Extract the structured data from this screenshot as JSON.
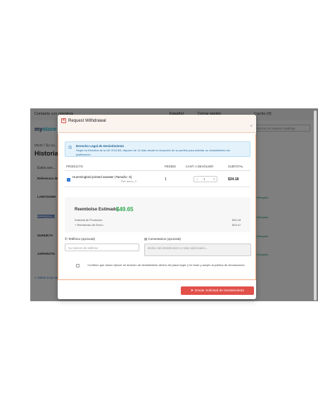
{
  "background_site": {
    "contact": "Contacte con nosotros",
    "language": "Español",
    "signin": "Cerrar sesión",
    "cart": "Carrito (0)",
    "logo_a": "my",
    "logo_b": "store",
    "search_placeholder": "Buscar en nuestro catálogo",
    "breadcrumb": "Inicio / Su cu...",
    "page_title": "Historial",
    "sub": "Estos son...",
    "rows": [
      "Referencia del pedido",
      "LAMYGUNH",
      "DRHQSULJ",
      "UUHUILTA",
      "AXPHSUTG"
    ],
    "badges": [
      "Entregado",
      "Entregado",
      "Entregado",
      "Entregado"
    ],
    "footer_link": "< Volver a su cuenta",
    "bottom_link": "Volver a su cuenta"
  },
  "modal": {
    "title": "Request Withdrawal",
    "close_icon": "times",
    "legal": {
      "icon": "gavel-icon",
      "title": "Derecho Legal de Desistimiento",
      "text": "Según la Directiva de la UE 2011/83, dispone de 14 días desde la recepción de su pedido para solicitar un desistimiento sin justificación."
    },
    "table": {
      "headers": [
        "PRODUCTO",
        "PEDIDO",
        "CANT. A DEVOLVER",
        "SUBTOTAL"
      ],
      "rows": [
        {
          "name": "Hummingbird printed sweater (Tamaño: S)",
          "ref": "Ref: demo_3",
          "qty": "1",
          "return_qty": "1",
          "subtotal": "$34.18"
        }
      ]
    },
    "refund": {
      "label": "Reembolso Estimado",
      "amount": "$49.65",
      "subtotal_label": "Subtotal de Productos",
      "subtotal_value": "$34.18",
      "shipping_label": "+ Reembolso de Envío",
      "shipping_value": "$15.47"
    },
    "phone": {
      "label": "Teléfono (opcional)",
      "placeholder": "Su número de teléfono"
    },
    "comments": {
      "label": "Comentarios (opcional)",
      "placeholder": "Motivo del desistimiento o notas adicionales..."
    },
    "confirm_text": "Confirmo que deseo ejercer mi derecho de desistimiento dentro del plazo legal, y he leído y acepto la política de devoluciones",
    "submit_label": "Enviar Solicitud de Desistimiento"
  },
  "colors": {
    "accent_red": "#e2504a",
    "refund_green": "#2fa84f",
    "info_blue": "#1f5f8f"
  }
}
